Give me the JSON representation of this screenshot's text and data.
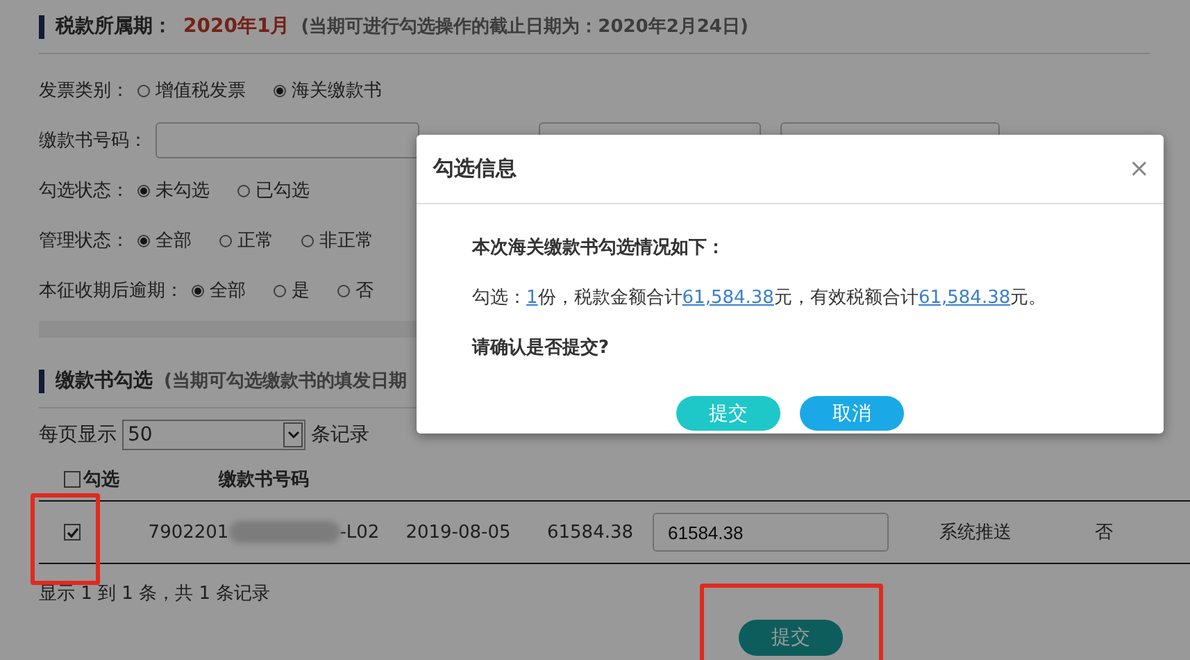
{
  "period": {
    "label": "税款所属期：",
    "value": "2020年1月",
    "note": "(当期可进行勾选操作的截止日期为：2020年2月24日)"
  },
  "filters": [
    {
      "kind": "radio",
      "label": "发票类别：",
      "options": [
        {
          "label": "增值税发票",
          "selected": false
        },
        {
          "label": "海关缴款书",
          "selected": true
        }
      ]
    },
    {
      "kind": "input",
      "label": "缴款书号码："
    },
    {
      "kind": "radio",
      "label": "勾选状态：",
      "options": [
        {
          "label": "未勾选",
          "selected": true
        },
        {
          "label": "已勾选",
          "selected": false
        }
      ]
    },
    {
      "kind": "radio",
      "label": "管理状态：",
      "options": [
        {
          "label": "全部",
          "selected": true
        },
        {
          "label": "正常",
          "selected": false
        },
        {
          "label": "非正常",
          "selected": false
        }
      ]
    },
    {
      "kind": "radio",
      "label": "本征收期后逾期：",
      "options": [
        {
          "label": "全部",
          "selected": true
        },
        {
          "label": "是",
          "selected": false
        },
        {
          "label": "否",
          "selected": false
        }
      ]
    }
  ],
  "section": {
    "title": "缴款书勾选",
    "note": "(当期可勾选缴款书的填发日期"
  },
  "page_size": {
    "label": "每页显示",
    "value": "50",
    "suffix": "条记录"
  },
  "table": {
    "select_all": {
      "label": "勾选",
      "checked": false
    },
    "column_2": "缴款书号码",
    "rows": [
      {
        "checked": true,
        "number_start": "7902201",
        "number_end": "-L02",
        "date": "2019-08-05",
        "amount": "61584.38",
        "effective": "61584.38",
        "source": "系统推送",
        "column_8": "否"
      }
    ]
  },
  "footer": "显示 1 到 1 条，共 1 条记录",
  "submit": "提交",
  "dialog": {
    "title": "勾选信息",
    "close": "×",
    "heading": "本次海关缴款书勾选情况如下：",
    "summary": [
      {
        "kind": "text",
        "text": "勾选："
      },
      {
        "kind": "link",
        "text": "1"
      },
      {
        "kind": "text",
        "text": "份，税款金额合计"
      },
      {
        "kind": "link",
        "text": "61,584.38"
      },
      {
        "kind": "text",
        "text": "元，有效税额合计"
      },
      {
        "kind": "link",
        "text": "61,584.38"
      },
      {
        "kind": "text",
        "text": "元。"
      }
    ],
    "question": "请确认是否提交?",
    "buttons": [
      {
        "kind": "confirm",
        "label": "提交"
      },
      {
        "kind": "cancel",
        "label": "取消"
      }
    ]
  }
}
